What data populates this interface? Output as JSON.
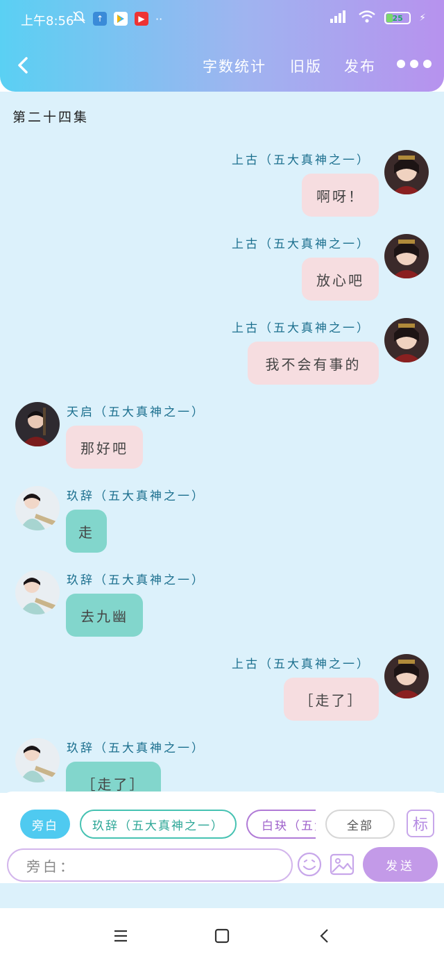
{
  "status": {
    "time": "上午8:56",
    "battery": "25"
  },
  "header": {
    "word_count": "字数统计",
    "old_version": "旧版",
    "publish": "发布"
  },
  "episode_title": "第二十四集",
  "messages": [
    {
      "name": "上古（五大真神之一）",
      "text": "啊呀！"
    },
    {
      "name": "上古（五大真神之一）",
      "text": "放心吧"
    },
    {
      "name": "上古（五大真神之一）",
      "text": "我不会有事的"
    },
    {
      "name": "天启（五大真神之一）",
      "text": "那好吧"
    },
    {
      "name": "玖辞（五大真神之一）",
      "text": "走"
    },
    {
      "name": "玖辞（五大真神之一）",
      "text": "去九幽"
    },
    {
      "name": "上古（五大真神之一）",
      "text": "［走了］"
    },
    {
      "name": "玖辞（五大真神之一）",
      "text": "［走了］"
    }
  ],
  "role_tabs": [
    {
      "label": "旁白"
    },
    {
      "label": "玖辞（五大真神之一）"
    },
    {
      "label": "白玦（五大真神之一）"
    },
    {
      "label": "全部"
    }
  ],
  "mark_label": "标",
  "input": {
    "value": "旁白："
  },
  "send_label": "发送",
  "colors": {
    "accent_purple": "#c39ae8",
    "accent_blue": "#4fcaf0",
    "chat_bg": "#dcf1fb",
    "pink_bubble": "#f6dde0",
    "teal_bubble": "#82d6cc"
  }
}
